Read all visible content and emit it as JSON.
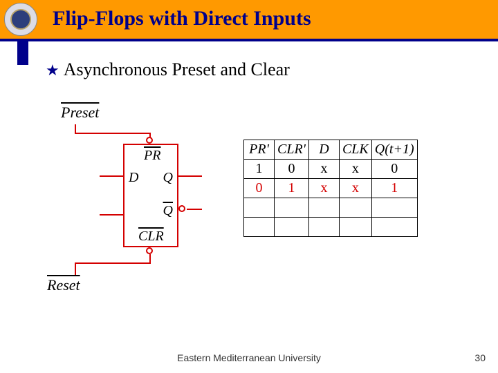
{
  "header": {
    "title": "Flip-Flops with Direct Inputs"
  },
  "bullet": {
    "text": "Asynchronous Preset and Clear"
  },
  "circuit": {
    "preset": "Preset",
    "reset": "Reset",
    "pr": "PR",
    "d": "D",
    "q": "Q",
    "qbar": "Q",
    "clr": "CLR"
  },
  "table": {
    "headers": {
      "pr": "PR'",
      "clr": "CLR'",
      "d": "D",
      "clk": "CLK",
      "qnext": "Q(t+1)"
    },
    "rows": [
      {
        "pr": "1",
        "clr": "0",
        "d": "x",
        "clk": "x",
        "q": "0"
      },
      {
        "pr": "0",
        "clr": "1",
        "d": "x",
        "clk": "x",
        "q": "1"
      }
    ]
  },
  "chart_data": {
    "type": "table",
    "title": "D flip-flop with asynchronous preset/clear — characteristic table",
    "columns": [
      "PR'",
      "CLR'",
      "D",
      "CLK",
      "Q(t+1)"
    ],
    "rows": [
      [
        "1",
        "0",
        "x",
        "x",
        "0"
      ],
      [
        "0",
        "1",
        "x",
        "x",
        "1"
      ]
    ]
  },
  "footer": {
    "org": "Eastern Mediterranean University",
    "page": "30"
  }
}
